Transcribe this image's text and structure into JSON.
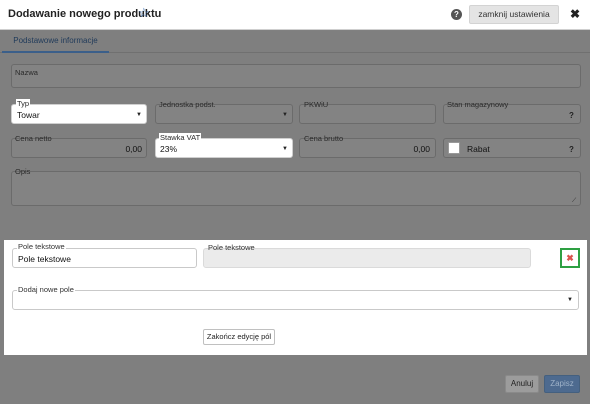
{
  "header": {
    "title": "Dodawanie nowego produktu",
    "star_icon": "star-outline-icon",
    "help_icon": "help-icon",
    "close_settings_label": "zamknij ustawienia",
    "close_icon": "close-icon"
  },
  "tabs": [
    {
      "label": "Podstawowe informacje",
      "active": true
    }
  ],
  "form": {
    "nazwa": {
      "label": "Nazwa",
      "value": ""
    },
    "typ": {
      "label": "Typ",
      "value": "Towar"
    },
    "jednostka": {
      "label": "Jednostka podst.",
      "value": ""
    },
    "pkwiu": {
      "label": "PKWiU",
      "value": ""
    },
    "stan": {
      "label": "Stan magazynowy",
      "value": "",
      "help": "?"
    },
    "cena_netto": {
      "label": "Cena netto",
      "value": "0,00"
    },
    "stawka_vat": {
      "label": "Stawka VAT",
      "value": "23%"
    },
    "cena_brutto": {
      "label": "Cena brutto",
      "value": "0,00"
    },
    "rabat": {
      "label": "Rabat",
      "checked": false,
      "help": "?"
    },
    "opis": {
      "label": "Opis",
      "value": ""
    }
  },
  "custom_fields": {
    "name_label": "Pole tekstowe",
    "name_value": "Pole tekstowe",
    "preview_label": "Pole tekstowe",
    "preview_value": "",
    "delete_icon": "delete-x-icon",
    "add_field_label": "Dodaj nowe pole",
    "add_field_value": "",
    "finish_button": "Zakończ edycję pól"
  },
  "footer": {
    "cancel_label": "Anuluj",
    "save_label": "Zapisz"
  },
  "colors": {
    "accent": "#3b5f8a",
    "delete_highlight": "#2ea043",
    "delete_icon": "#d9534f"
  }
}
